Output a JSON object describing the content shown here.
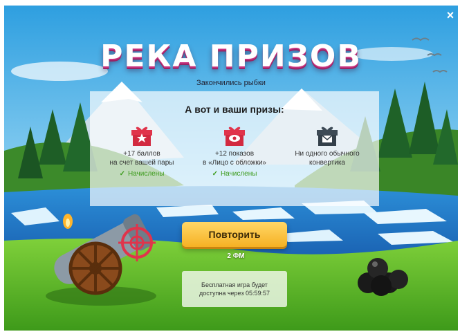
{
  "window": {
    "close_label": "×"
  },
  "title": "РЕКА ПРИЗОВ",
  "subtitle": "Закончились рыбки",
  "panel": {
    "heading": "А вот и ваши призы:",
    "prizes": [
      {
        "icon": "gift-star-icon",
        "line1": "+17 баллов",
        "line2": "на счет вашей пары",
        "status": "Начислены"
      },
      {
        "icon": "gift-eye-icon",
        "line1": "+12 показов",
        "line2": "в «Лицо с обложки»",
        "status": "Начислены"
      },
      {
        "icon": "gift-envelope-icon",
        "line1": "Ни одного обычного",
        "line2": "конвертика",
        "status": ""
      }
    ]
  },
  "retry_button": {
    "label": "Повторить"
  },
  "cost": "2 ФМ",
  "free_game": {
    "line1": "Бесплатная игра будет",
    "line2": "доступна через 05:59:57"
  },
  "colors": {
    "button": "#f6b124",
    "accent": "#e0344b",
    "ok_green": "#3c9b1c",
    "title_shadow": "#c7327e"
  }
}
